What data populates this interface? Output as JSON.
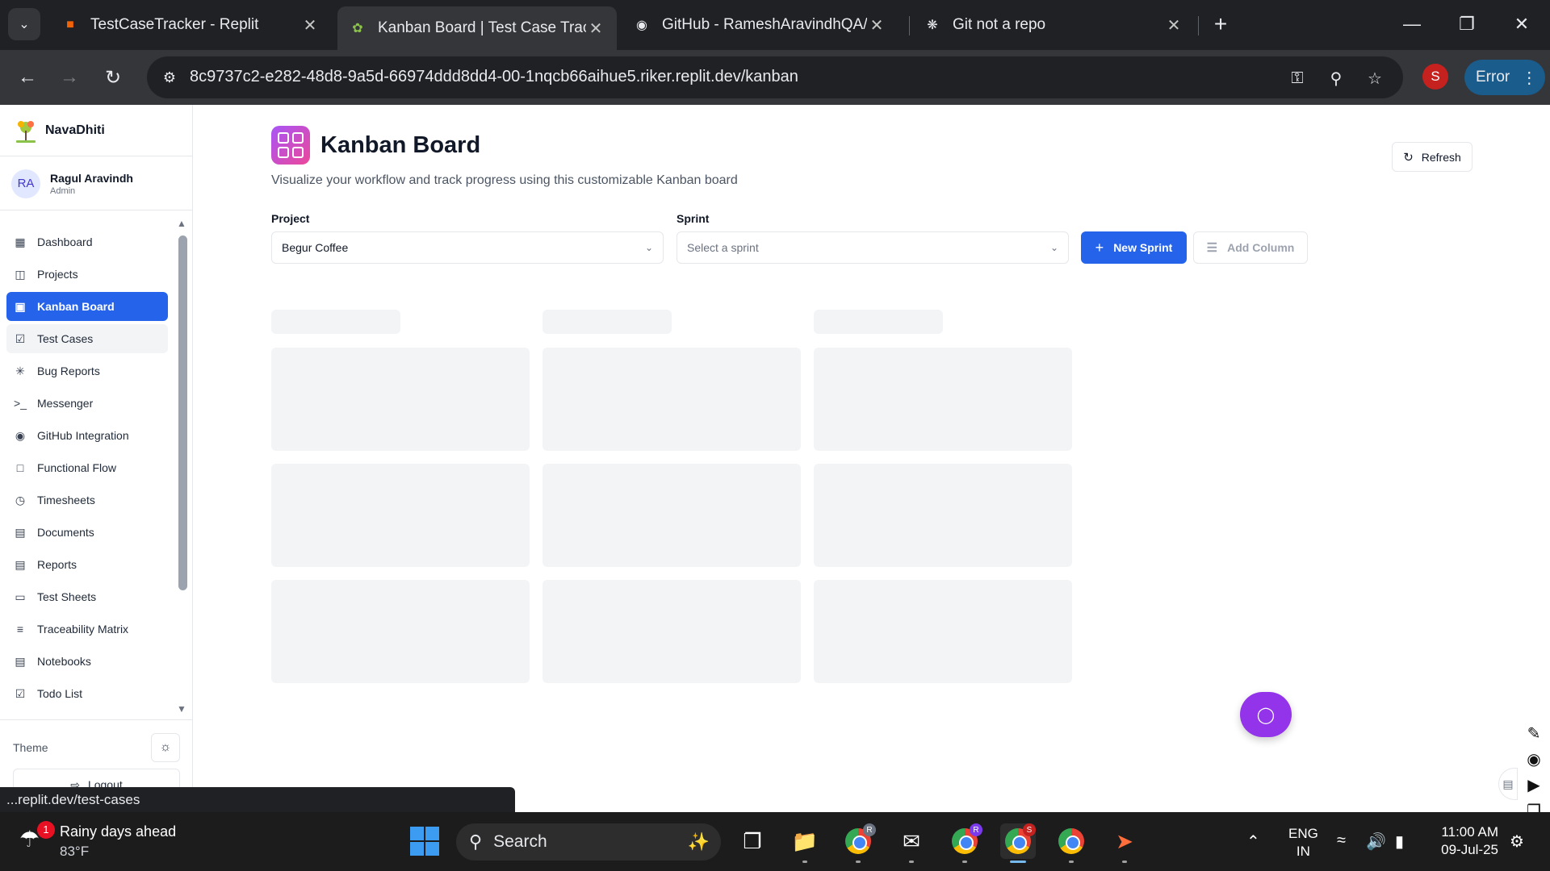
{
  "browser": {
    "tabs": [
      {
        "title": "TestCaseTracker - Replit",
        "icon": "replit-icon"
      },
      {
        "title": "Kanban Board | Test Case Tracker",
        "icon": "navadhiti-icon"
      },
      {
        "title": "GitHub - RameshAravindhQA/Test",
        "icon": "github-icon"
      },
      {
        "title": "Git not a repo",
        "icon": "openai-icon"
      }
    ],
    "url": "8c9737c2-e282-48d8-9a5d-66974ddd8dd4-00-1nqcb66aihue5.riker.replit.dev/kanban",
    "profile_initial": "S",
    "error_label": "Error"
  },
  "sidebar": {
    "brand": "NavaDhiti",
    "user": {
      "initials": "RA",
      "name": "Ragul Aravindh",
      "role": "Admin"
    },
    "items": [
      {
        "label": "Dashboard",
        "icon": "dashboard-icon"
      },
      {
        "label": "Projects",
        "icon": "folder-icon"
      },
      {
        "label": "Kanban Board",
        "icon": "kanban-icon"
      },
      {
        "label": "Test Cases",
        "icon": "checkbox-icon"
      },
      {
        "label": "Bug Reports",
        "icon": "bug-icon"
      },
      {
        "label": "Messenger",
        "icon": "terminal-icon"
      },
      {
        "label": "GitHub Integration",
        "icon": "github-icon"
      },
      {
        "label": "Functional Flow",
        "icon": "flow-icon"
      },
      {
        "label": "Timesheets",
        "icon": "clock-icon"
      },
      {
        "label": "Documents",
        "icon": "document-icon"
      },
      {
        "label": "Reports",
        "icon": "report-icon"
      },
      {
        "label": "Test Sheets",
        "icon": "sheet-icon"
      },
      {
        "label": "Traceability Matrix",
        "icon": "filter-icon"
      },
      {
        "label": "Notebooks",
        "icon": "notebook-icon"
      },
      {
        "label": "Todo List",
        "icon": "todo-icon"
      }
    ],
    "active_item": "Kanban Board",
    "hover_item": "Test Cases",
    "theme_label": "Theme",
    "logout_label": "Logout"
  },
  "main": {
    "title": "Kanban Board",
    "subtitle": "Visualize your workflow and track progress using this customizable Kanban board",
    "refresh_label": "Refresh",
    "project_label": "Project",
    "project_value": "Begur Coffee",
    "sprint_label": "Sprint",
    "sprint_placeholder": "Select a sprint",
    "new_sprint_label": "New Sprint",
    "add_column_label": "Add Column"
  },
  "status_tip": "...replit.dev/test-cases",
  "taskbar": {
    "weather_title": "Rainy days ahead",
    "weather_temp": "83°F",
    "weather_badge": "1",
    "search_label": "Search",
    "lang_line1": "ENG",
    "lang_line2": "IN",
    "time": "11:00 AM",
    "date": "09-Jul-25",
    "badges": [
      "R",
      "R",
      "S"
    ]
  },
  "colors": {
    "accent": "#2563eb",
    "chat_fab": "#9333ea"
  }
}
